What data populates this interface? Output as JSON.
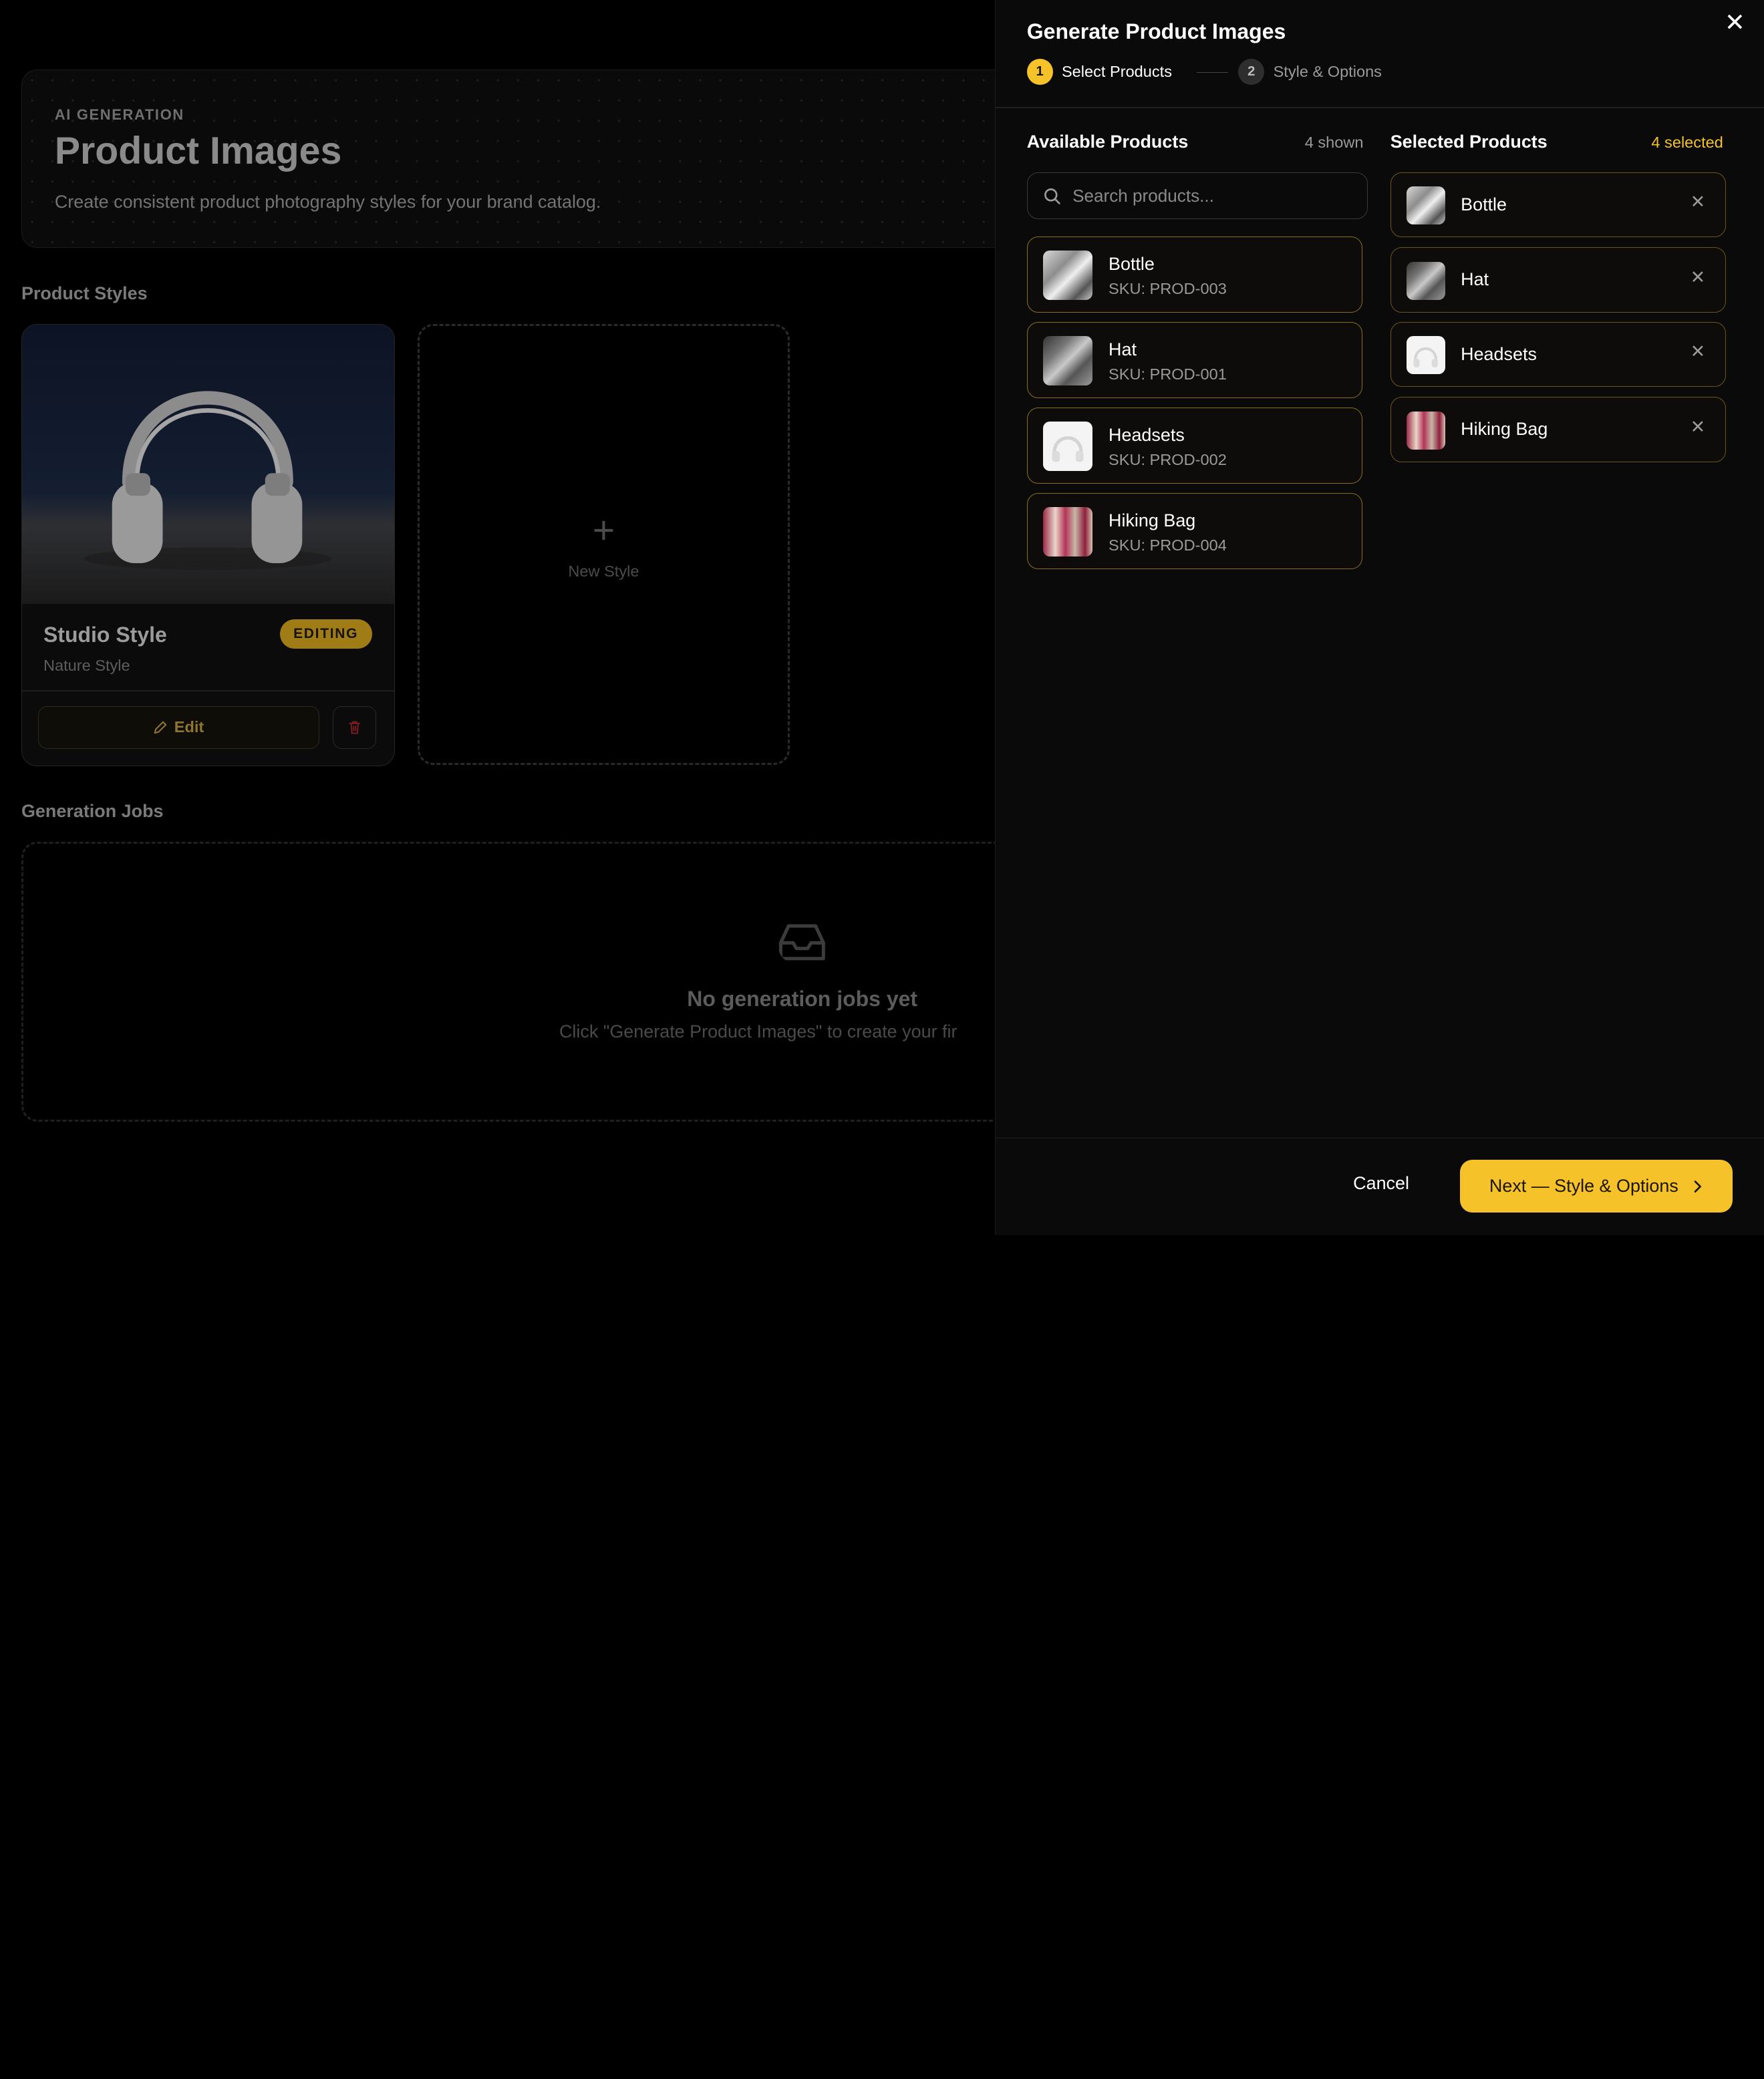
{
  "background": {
    "hero": {
      "eyebrow": "AI GENERATION",
      "title": "Product Images",
      "subtitle": "Create consistent product photography styles for your brand catalog."
    },
    "product_styles_title": "Product Styles",
    "style_card": {
      "name": "Studio Style",
      "sub": "Nature Style",
      "badge": "EDITING",
      "edit_label": "Edit"
    },
    "new_style_label": "New Style",
    "generation_jobs_title": "Generation Jobs",
    "jobs_empty": {
      "title": "No generation jobs yet",
      "subtitle": "Click \"Generate Product Images\" to create your fir"
    }
  },
  "panel": {
    "title": "Generate Product Images",
    "steps": [
      {
        "num": "1",
        "label": "Select Products"
      },
      {
        "num": "2",
        "label": "Style & Options"
      }
    ],
    "available": {
      "title": "Available Products",
      "count": "4 shown",
      "search_placeholder": "Search products...",
      "items": [
        {
          "name": "Bottle",
          "sku": "SKU: PROD-003"
        },
        {
          "name": "Hat",
          "sku": "SKU: PROD-001"
        },
        {
          "name": "Headsets",
          "sku": "SKU: PROD-002"
        },
        {
          "name": "Hiking Bag",
          "sku": "SKU: PROD-004"
        }
      ]
    },
    "selected": {
      "title": "Selected Products",
      "count": "4 selected",
      "items": [
        {
          "name": "Bottle"
        },
        {
          "name": "Hat"
        },
        {
          "name": "Headsets"
        },
        {
          "name": "Hiking Bag"
        }
      ]
    },
    "footer": {
      "cancel": "Cancel",
      "next": "Next — Style & Options"
    }
  },
  "colors": {
    "accent": "#f5c22a",
    "card_border": "#8a6d1c",
    "panel_bg": "#0a0a0a"
  }
}
